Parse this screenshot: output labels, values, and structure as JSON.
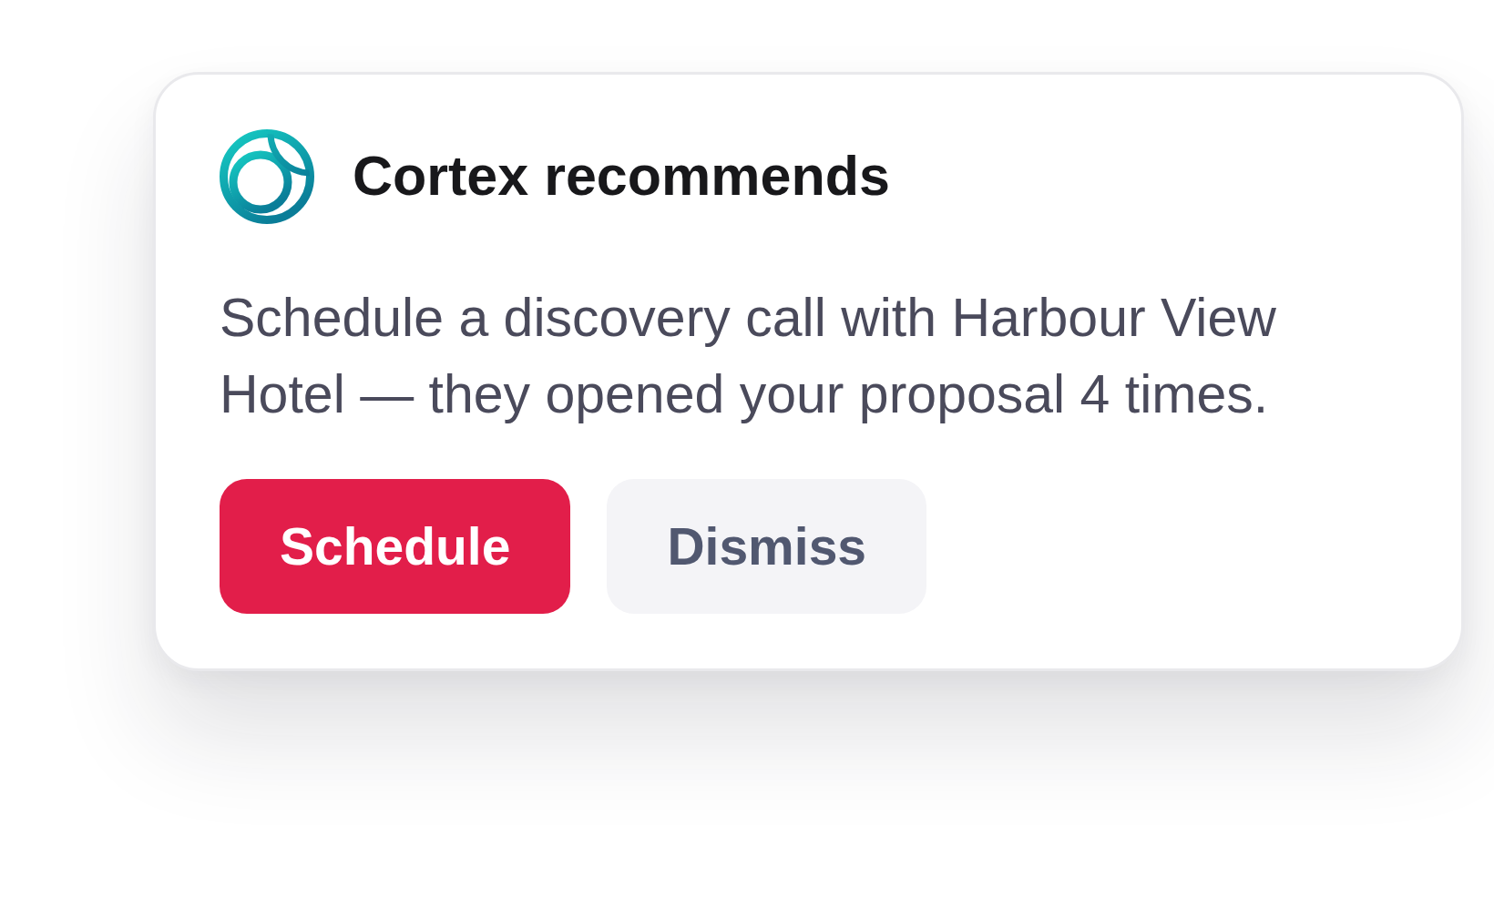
{
  "card": {
    "title": "Cortex recommends",
    "message": "Schedule a discovery call with Harbour View Hotel — they opened your proposal 4 times.",
    "actions": [
      {
        "label": "Schedule",
        "kind": "primary"
      },
      {
        "label": "Dismiss",
        "kind": "secondary"
      }
    ]
  }
}
